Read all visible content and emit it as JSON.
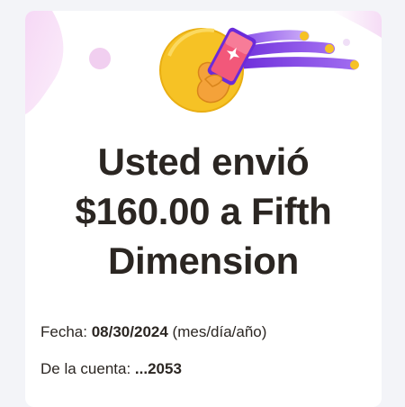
{
  "confirmation": {
    "title_line1": "Usted envió",
    "title_line2": "$160.00 a Fifth",
    "title_line3": "Dimension"
  },
  "details": {
    "date_label": "Fecha:",
    "date_value": "08/30/2024",
    "date_format_hint": "(mes/día/año)",
    "account_label": "De la cuenta:",
    "account_value": "...2053"
  },
  "colors": {
    "accent_purple": "#6b2bd9",
    "gold": "#f6c225",
    "text": "#2b2622",
    "pink_bubble": "#f3d8f3"
  },
  "icons": {
    "hero": "hand-holding-phone-coin-illustration"
  }
}
